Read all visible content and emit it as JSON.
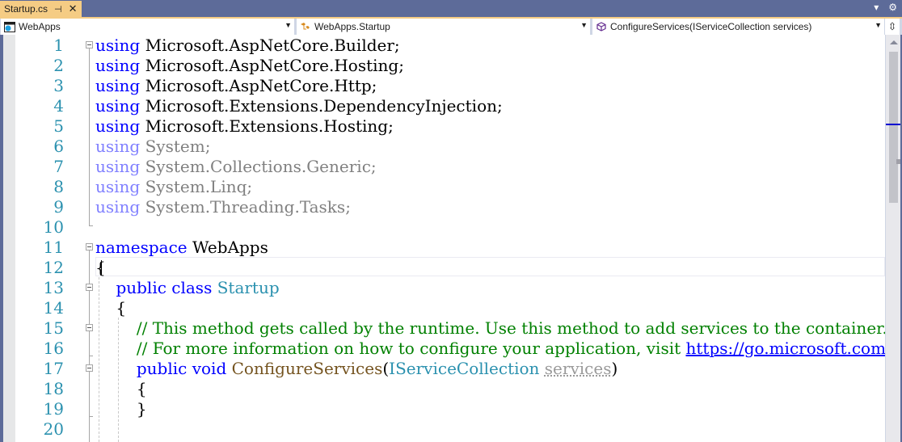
{
  "tab": {
    "title": "Startup.cs",
    "pin_icon": "pin-icon",
    "close_icon": "close-icon"
  },
  "tabbar_controls": {
    "dropdown_icon": "▾",
    "settings_icon": "⚙"
  },
  "navigation": {
    "project": "WebApps",
    "type": "WebApps.Startup",
    "member": "ConfigureServices(IServiceCollection services)"
  },
  "editor": {
    "current_line": 12,
    "lines": [
      {
        "n": "1",
        "parts": [
          {
            "c": "kw",
            "t": "using"
          },
          {
            "c": "",
            "t": " Microsoft.AspNetCore.Builder;"
          }
        ]
      },
      {
        "n": "2",
        "parts": [
          {
            "c": "kw",
            "t": "using"
          },
          {
            "c": "",
            "t": " Microsoft.AspNetCore.Hosting;"
          }
        ]
      },
      {
        "n": "3",
        "parts": [
          {
            "c": "kw",
            "t": "using"
          },
          {
            "c": "",
            "t": " Microsoft.AspNetCore.Http;"
          }
        ]
      },
      {
        "n": "4",
        "parts": [
          {
            "c": "kw",
            "t": "using"
          },
          {
            "c": "",
            "t": " Microsoft.Extensions.DependencyInjection;"
          }
        ]
      },
      {
        "n": "5",
        "parts": [
          {
            "c": "kw",
            "t": "using"
          },
          {
            "c": "",
            "t": " Microsoft.Extensions.Hosting;"
          }
        ]
      },
      {
        "n": "6",
        "parts": [
          {
            "c": "kw-dim",
            "t": "using"
          },
          {
            "c": "dim",
            "t": " System;"
          }
        ]
      },
      {
        "n": "7",
        "parts": [
          {
            "c": "kw-dim",
            "t": "using"
          },
          {
            "c": "dim",
            "t": " System.Collections.Generic;"
          }
        ]
      },
      {
        "n": "8",
        "parts": [
          {
            "c": "kw-dim",
            "t": "using"
          },
          {
            "c": "dim",
            "t": " System.Linq;"
          }
        ]
      },
      {
        "n": "9",
        "parts": [
          {
            "c": "kw-dim",
            "t": "using"
          },
          {
            "c": "dim",
            "t": " System.Threading.Tasks;"
          }
        ]
      },
      {
        "n": "10",
        "parts": []
      },
      {
        "n": "11",
        "parts": [
          {
            "c": "kw",
            "t": "namespace"
          },
          {
            "c": "",
            "t": " WebApps"
          }
        ]
      },
      {
        "n": "12",
        "parts": [
          {
            "c": "",
            "t": "{"
          }
        ]
      },
      {
        "n": "13",
        "parts": [
          {
            "c": "",
            "t": "    "
          },
          {
            "c": "kw",
            "t": "public"
          },
          {
            "c": "",
            "t": " "
          },
          {
            "c": "kw",
            "t": "class"
          },
          {
            "c": "",
            "t": " "
          },
          {
            "c": "type",
            "t": "Startup"
          }
        ]
      },
      {
        "n": "14",
        "parts": [
          {
            "c": "",
            "t": "    {"
          }
        ]
      },
      {
        "n": "15",
        "parts": [
          {
            "c": "",
            "t": "        "
          },
          {
            "c": "cmt",
            "t": "// This method gets called by the runtime. Use this method to add services to the container."
          }
        ]
      },
      {
        "n": "16",
        "parts": [
          {
            "c": "",
            "t": "        "
          },
          {
            "c": "cmt",
            "t": "// For more information on how to configure your application, visit "
          },
          {
            "c": "link",
            "t": "https://go.microsoft.com/f"
          }
        ]
      },
      {
        "n": "17",
        "parts": [
          {
            "c": "",
            "t": "        "
          },
          {
            "c": "kw",
            "t": "public"
          },
          {
            "c": "",
            "t": " "
          },
          {
            "c": "kw",
            "t": "void"
          },
          {
            "c": "",
            "t": " "
          },
          {
            "c": "method",
            "t": "ConfigureServices"
          },
          {
            "c": "",
            "t": "("
          },
          {
            "c": "type",
            "t": "IServiceCollection"
          },
          {
            "c": "",
            "t": " "
          },
          {
            "c": "param-dim",
            "t": "services"
          },
          {
            "c": "",
            "t": ")"
          }
        ]
      },
      {
        "n": "18",
        "parts": [
          {
            "c": "",
            "t": "        {"
          }
        ]
      },
      {
        "n": "19",
        "parts": [
          {
            "c": "",
            "t": "        }"
          }
        ]
      },
      {
        "n": "20",
        "parts": []
      }
    ]
  },
  "colors": {
    "keyword": "#0000ff",
    "type": "#2b91af",
    "comment": "#008000",
    "method": "#74531f",
    "line_number": "#2b91af",
    "tab_active": "#f5cc84",
    "chrome": "#5d6b99"
  }
}
